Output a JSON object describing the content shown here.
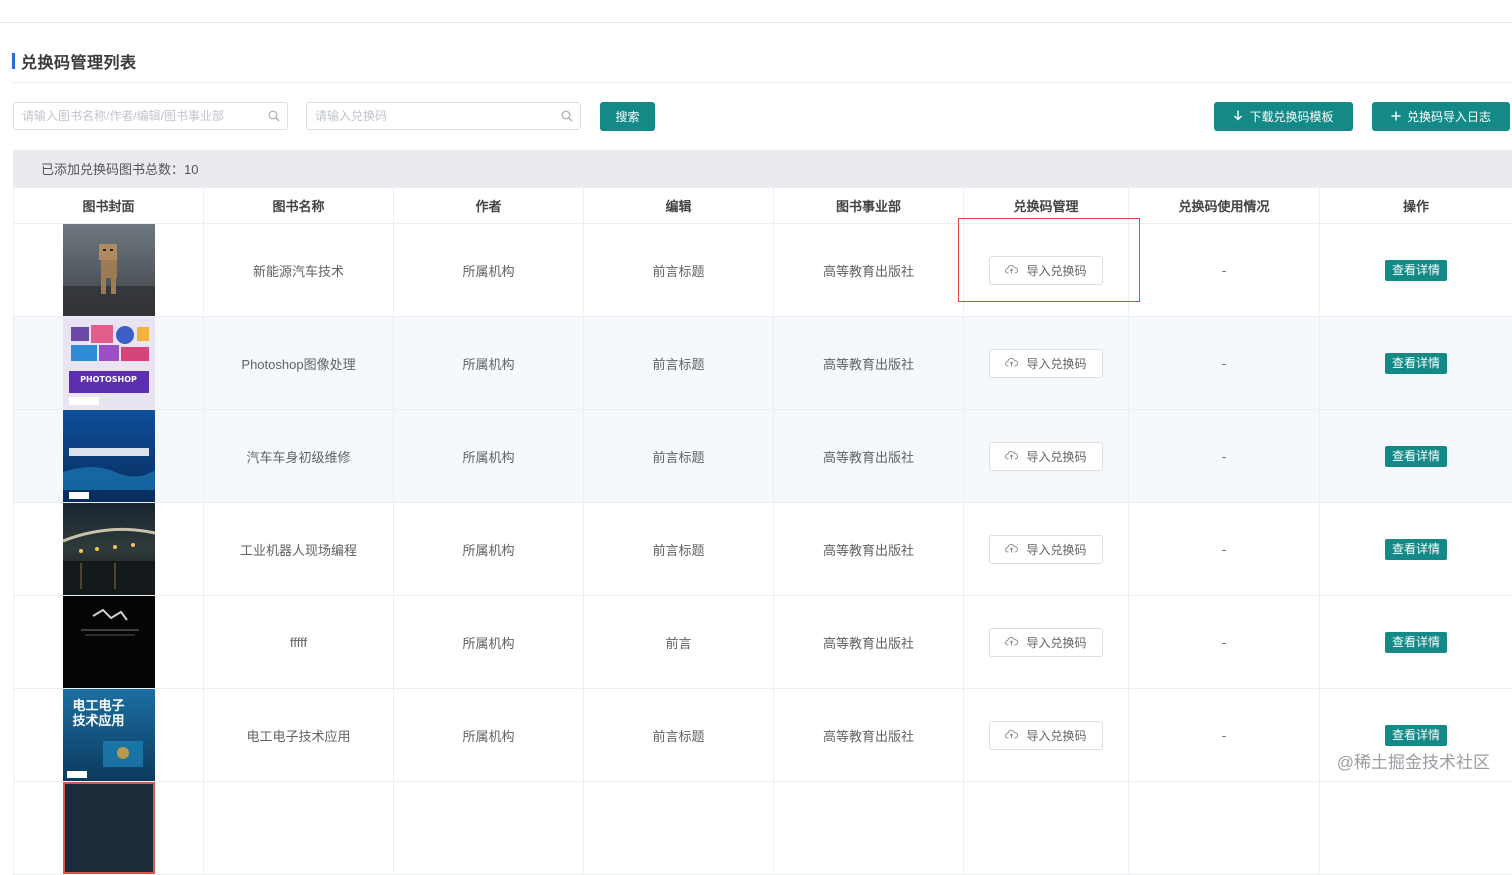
{
  "page": {
    "title": "兑换码管理列表"
  },
  "search": {
    "book_placeholder": "请输入图书名称/作者/编辑/图书事业部",
    "code_placeholder": "请输入兑换码",
    "search_label": "搜索"
  },
  "actions": {
    "download_template_label": "下载兑换码模板",
    "import_log_label": "兑换码导入日志"
  },
  "summary": {
    "count_text": "已添加兑换码图书总数：10"
  },
  "table": {
    "headers": [
      "图书封面",
      "图书名称",
      "作者",
      "编辑",
      "图书事业部",
      "兑换码管理",
      "兑换码使用情况",
      "操作"
    ],
    "rows": [
      {
        "name": "新能源汽车技术",
        "author": "所属机构",
        "editor": "前言标题",
        "dept": "高等教育出版社",
        "import_label": "导入兑换码",
        "usage": "-",
        "detail_label": "查看详情",
        "cover": "doll-photo"
      },
      {
        "name": "Photoshop图像处理",
        "author": "所属机构",
        "editor": "前言标题",
        "dept": "高等教育出版社",
        "import_label": "导入兑换码",
        "usage": "-",
        "detail_label": "查看详情",
        "cover": "photoshop-cover",
        "cover_text": "PHOTOSHOP"
      },
      {
        "name": "汽车车身初级维修",
        "author": "所属机构",
        "editor": "前言标题",
        "dept": "高等教育出版社",
        "import_label": "导入兑换码",
        "usage": "-",
        "detail_label": "查看详情",
        "cover": "blue-car-cover"
      },
      {
        "name": "工业机器人现场编程",
        "author": "所属机构",
        "editor": "前言标题",
        "dept": "高等教育出版社",
        "import_label": "导入兑换码",
        "usage": "-",
        "detail_label": "查看详情",
        "cover": "bridge-night-photo"
      },
      {
        "name": "fffff",
        "author": "所属机构",
        "editor": "前言",
        "dept": "高等教育出版社",
        "import_label": "导入兑换码",
        "usage": "-",
        "detail_label": "查看详情",
        "cover": "dark-cover"
      },
      {
        "name": "电工电子技术应用",
        "author": "所属机构",
        "editor": "前言标题",
        "dept": "高等教育出版社",
        "import_label": "导入兑换码",
        "usage": "-",
        "detail_label": "查看详情",
        "cover": "electrical-cover",
        "cover_text": "电工电子技术应用"
      }
    ]
  },
  "watermark": "@稀土掘金技术社区",
  "colors": {
    "primary": "#138a87",
    "title_mark": "#1e6fd9",
    "highlight": "#e64343"
  }
}
